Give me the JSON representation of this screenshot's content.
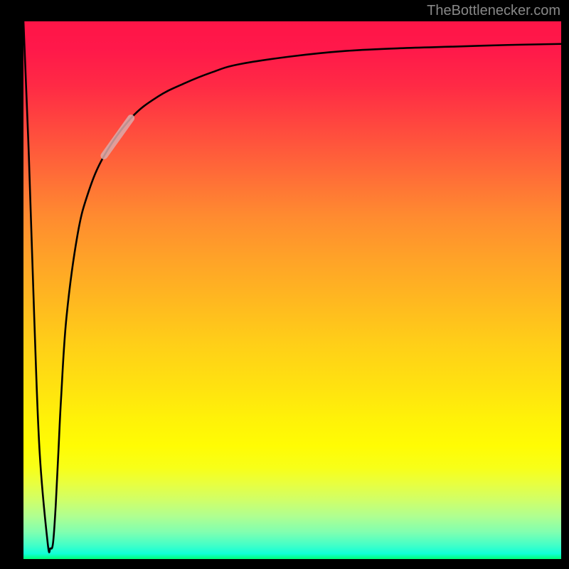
{
  "source_label": "TheBottlenecker.com",
  "chart_data": {
    "type": "line",
    "title": "",
    "xlabel": "",
    "ylabel": "",
    "xlim": [
      0,
      100
    ],
    "ylim": [
      0,
      100
    ],
    "series": [
      {
        "name": "bottleneck-curve",
        "style": "solid",
        "x": [
          0,
          1,
          2,
          3,
          4.5,
          5,
          5.5,
          6,
          6.5,
          7,
          8,
          10,
          12,
          15,
          20,
          25,
          30,
          35,
          40,
          50,
          60,
          70,
          80,
          90,
          100
        ],
        "y": [
          100,
          75,
          45,
          20,
          3,
          2,
          3,
          10,
          20,
          30,
          45,
          60,
          68,
          75,
          82,
          86,
          88.5,
          90.5,
          92,
          93.5,
          94.5,
          95,
          95.3,
          95.6,
          95.8
        ]
      },
      {
        "name": "highlight-segment",
        "style": "overlay",
        "x": [
          15,
          20
        ],
        "y": [
          75,
          82
        ]
      }
    ],
    "gradient_stops": [
      {
        "pos": 0,
        "color": "#ff1547"
      },
      {
        "pos": 50,
        "color": "#ffb820"
      },
      {
        "pos": 80,
        "color": "#fffc04"
      },
      {
        "pos": 100,
        "color": "#00ff78"
      }
    ]
  }
}
